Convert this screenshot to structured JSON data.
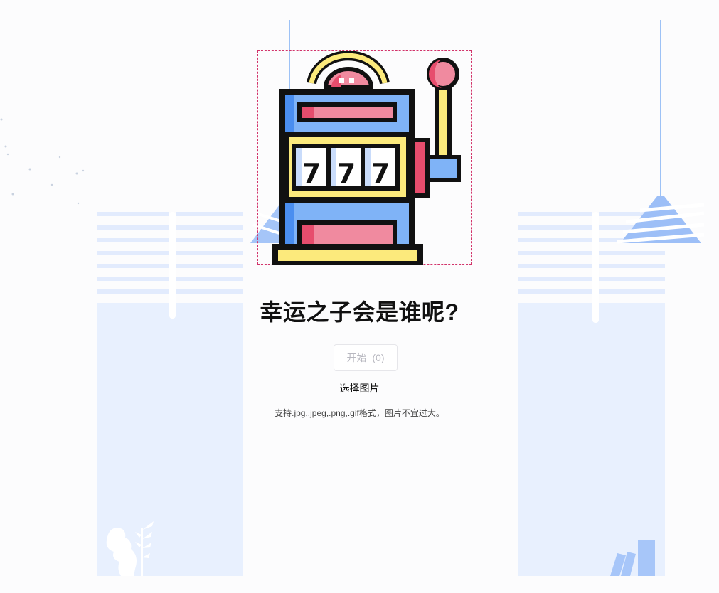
{
  "title": "幸运之子会是谁呢?",
  "start_button": {
    "label": "开始",
    "count": "(0)"
  },
  "select_image_label": "选择图片",
  "hint": "支持.jpg,.jpeg,.png,.gif格式，图片不宜过大。",
  "machine": {
    "reel_symbols": [
      "7",
      "7",
      "7"
    ]
  },
  "colors": {
    "page_background": "#fcfcfd",
    "panel_background": "#e8f0fe",
    "blind_stripe": "#dfe9fd",
    "lamp_blue": "#99c0f7",
    "machine_blue": "#7fb3f7",
    "machine_yellow": "#fcea7c",
    "machine_pink": "#f08a9f",
    "machine_red": "#e74d6d",
    "outline": "#111111",
    "dashed_border": "#d2336a"
  }
}
